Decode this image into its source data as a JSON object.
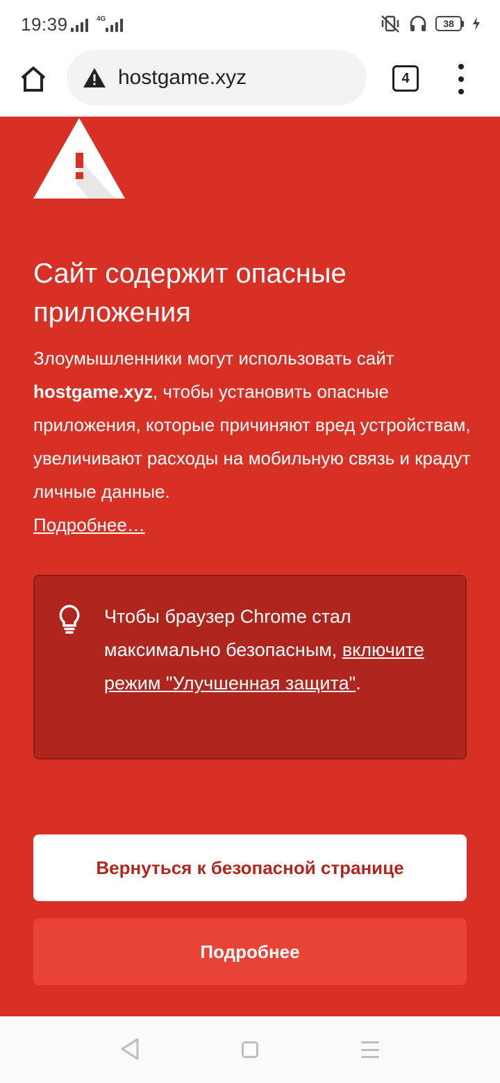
{
  "status_bar": {
    "time": "19:39",
    "network": "4G",
    "battery": "38"
  },
  "toolbar": {
    "url": "hostgame.xyz",
    "tab_count": "4"
  },
  "interstitial": {
    "heading": "Сайт содержит опасные приложения",
    "body_prefix": "Злоумышленники могут использовать сайт ",
    "body_site": "hostgame.xyz",
    "body_suffix": ", чтобы установить опасные приложения, которые причиняют вред устройствам, увеличивают расходы на мобильную связь и крадут личные данные.",
    "learn_more_link": "Подробнее…",
    "tip": {
      "text_prefix": "Чтобы браузер Chrome стал максимально безопасным, ",
      "link": "включите режим \"Улучшенная защита\"",
      "text_suffix": "."
    },
    "back_button": "Вернуться к безопасной странице",
    "details_button": "Подробнее"
  },
  "colors": {
    "background_red": "#d93025",
    "tip_box": "#b0251e",
    "back_button_text": "#b3261e",
    "details_button": "#e94336"
  }
}
